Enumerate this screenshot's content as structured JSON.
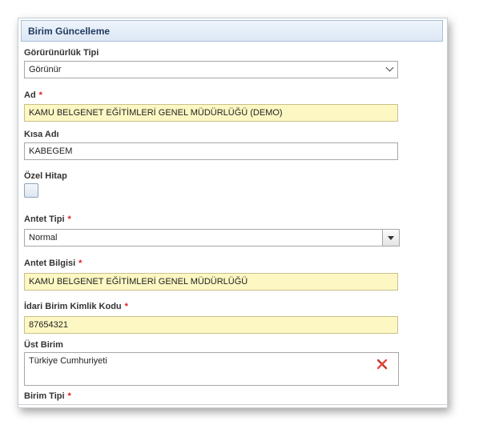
{
  "panel": {
    "title": "Birim Güncelleme"
  },
  "form": {
    "visibility_type": {
      "label": "Görürünürlük Tipi",
      "value": "Görünür"
    },
    "name": {
      "label": "Ad",
      "required_mark": "*",
      "value": "KAMU BELGENET EĞİTİMLERİ GENEL MÜDÜRLÜĞÜ (DEMO)"
    },
    "short_name": {
      "label": "Kısa Adı",
      "value": "KABEGEM"
    },
    "special_address": {
      "label": "Özel Hitap",
      "checked": false
    },
    "letterhead_type": {
      "label": "Antet Tipi",
      "required_mark": "*",
      "value": "Normal"
    },
    "letterhead_info": {
      "label": "Antet Bilgisi",
      "required_mark": "*",
      "value": "KAMU BELGENET EĞİTİMLERİ GENEL MÜDÜRLÜĞÜ"
    },
    "admin_unit_code": {
      "label": "İdari Birim Kimlik Kodu",
      "required_mark": "*",
      "value": "87654321"
    },
    "parent_unit": {
      "label": "Üst Birim",
      "value": "Türkiye Cumhuriyeti"
    },
    "unit_type": {
      "label": "Birim Tipi",
      "required_mark": "*"
    }
  },
  "colors": {
    "required": "#e01b1b",
    "highlight_field": "#fdf8c3",
    "header_text": "#1f3a5f"
  },
  "icons": {
    "clear": "red-x-icon",
    "dropdown": "chevron-down-icon"
  }
}
